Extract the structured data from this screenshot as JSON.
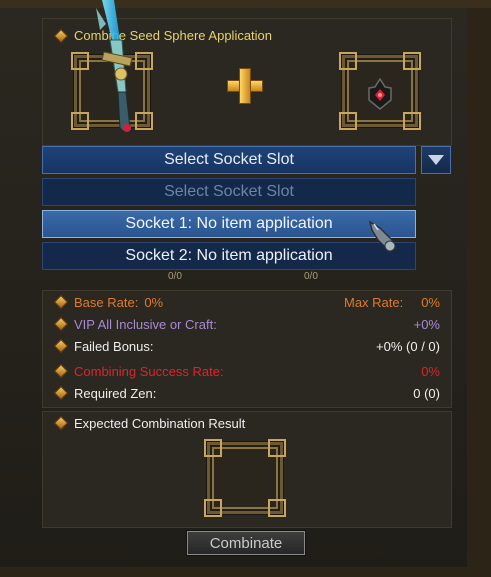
{
  "window": {
    "title": "Combine Seed Sphere Application"
  },
  "dropdown": {
    "selected": "Select Socket Slot",
    "options": [
      "Select Socket Slot",
      "Socket 1: No item application",
      "Socket 2: No item application"
    ],
    "highlighted_index": 1,
    "partial_labels": [
      "0/0",
      "0/0"
    ]
  },
  "stats": {
    "base_rate_label": "Base Rate:",
    "base_rate_value": "0%",
    "max_rate_label": "Max Rate:",
    "max_rate_value": "0%",
    "vip_label": "VIP All Inclusive or Craft:",
    "vip_value": "+0%",
    "failed_bonus_label": "Failed Bonus:",
    "failed_bonus_value": "+0% (0 / 0)",
    "success_rate_label": "Combining Success Rate:",
    "success_rate_value": "0%",
    "required_zen_label": "Required Zen:",
    "required_zen_value": "0 (0)"
  },
  "result": {
    "label": "Expected Combination Result"
  },
  "buttons": {
    "combinate_label": "Combinate"
  },
  "icons": {
    "item": "weapon-sword-icon",
    "seed": "seed-sphere-icon",
    "plus": "plus-icon",
    "cursor": "hand-cursor-icon",
    "arrow": "chevron-down-icon",
    "bullet": "diamond-bullet-icon"
  },
  "colors": {
    "header": "#e9d26a",
    "orange_stat": "#e07a2a",
    "vip": "#a98ad6",
    "success_rate": "#e0232b",
    "dropdown_bg": "#1f4378",
    "option_highlight": "#3a6aa8"
  }
}
